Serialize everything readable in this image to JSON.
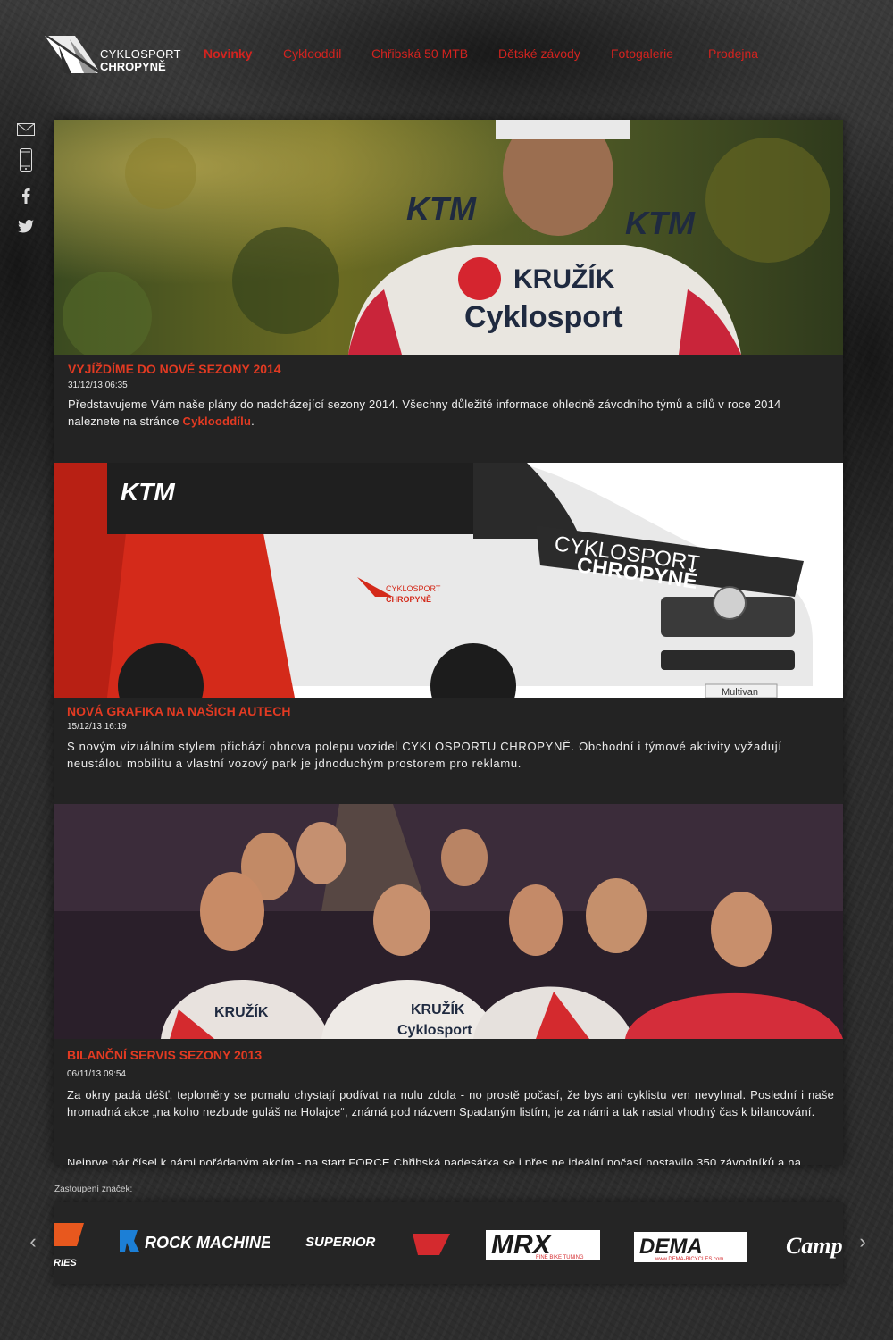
{
  "brand": {
    "line1": "CYKLOSPORT",
    "line2": "CHROPYNĚ"
  },
  "nav": [
    {
      "label": "Novinky",
      "active": true
    },
    {
      "label": "Cyklooddíl"
    },
    {
      "label": "Chřibská 50 MTB"
    },
    {
      "label": "Dětské závody"
    },
    {
      "label": "Fotogalerie"
    },
    {
      "label": "Prodejna"
    }
  ],
  "social": [
    "mail-icon",
    "phone-icon",
    "facebook-icon",
    "twitter-icon"
  ],
  "articles": [
    {
      "title": "VYJÍŽDÍME DO NOVÉ SEZONY 2014",
      "date": "31/12/13 06:35",
      "text_before_link": "Představujeme Vám naše plány do nadcházející sezony 2014. Všechny důležité informace ohledně závodního týmů a cílů v roce 2014 naleznete na stránce ",
      "link": "Cyklooddílu",
      "text_after_link": ".",
      "image_text": {
        "jersey_brand": "KTM",
        "jersey_sponsor": "KRUŽÍK",
        "jersey_shop": "Cyklosport"
      }
    },
    {
      "title": "NOVÁ GRAFIKA NA NAŠICH AUTECH",
      "date": "15/12/13 16:19",
      "text": "S novým vizuálním stylem přichází obnova polepu vozidel CYKLOSPORTU CHROPYNĚ. Obchodní i týmové aktivity vyžadují neustálou mobilitu a vlastní vozový park je jdnoduchým prostorem pro reklamu.",
      "image_text": {
        "door_brand": "KTM",
        "door_logo_line1": "CYKLOSPORT",
        "door_logo_line2": "CHROPYNĚ",
        "hood_line1": "CYKLOSPORT",
        "hood_line2": "CHROPYNĚ",
        "plate": "Multivan"
      }
    },
    {
      "title": "BILANČNÍ SERVIS SEZONY 2013",
      "date": "06/11/13 09:54",
      "text": "Za okny padá déšť, teploměry se pomalu chystají podívat na nulu zdola - no prostě počasí, že bys ani cyklistu ven nevyhnal. Poslední i naše hromadná akce „na koho nezbude guláš na Holajce“, známá pod názvem Spadaným listím, je za námi a tak nastal vhodný čas k bilancování.",
      "text2": "Nejprve pár čísel k námi pořádaným akcím - na start FORCE Chřibská padesátka se i přes ne ideální počasí postavilo 350 závodníků a na",
      "image_text": {
        "jersey_sponsor": "KRUŽÍK",
        "jersey_shop": "Cyklosport"
      }
    }
  ],
  "brands_label": "Zastoupení značek:",
  "brands": [
    {
      "name": "ktm-logo",
      "label": "RIES"
    },
    {
      "name": "rock-machine-logo",
      "label": "ROCK MACHINE"
    },
    {
      "name": "superior-logo",
      "label": "SUPERIOR"
    },
    {
      "name": "mrx-logo",
      "label": "MRX",
      "sub": "FINE BIKE TUNING"
    },
    {
      "name": "dema-logo",
      "label": "DEMA",
      "sub": "www.DEMA-BICYCLES.com"
    },
    {
      "name": "campagnolo-logo",
      "label": "Camp"
    }
  ],
  "colors": {
    "accent": "#d2231f",
    "panel": "#232323",
    "background": "#2f2f2f"
  }
}
